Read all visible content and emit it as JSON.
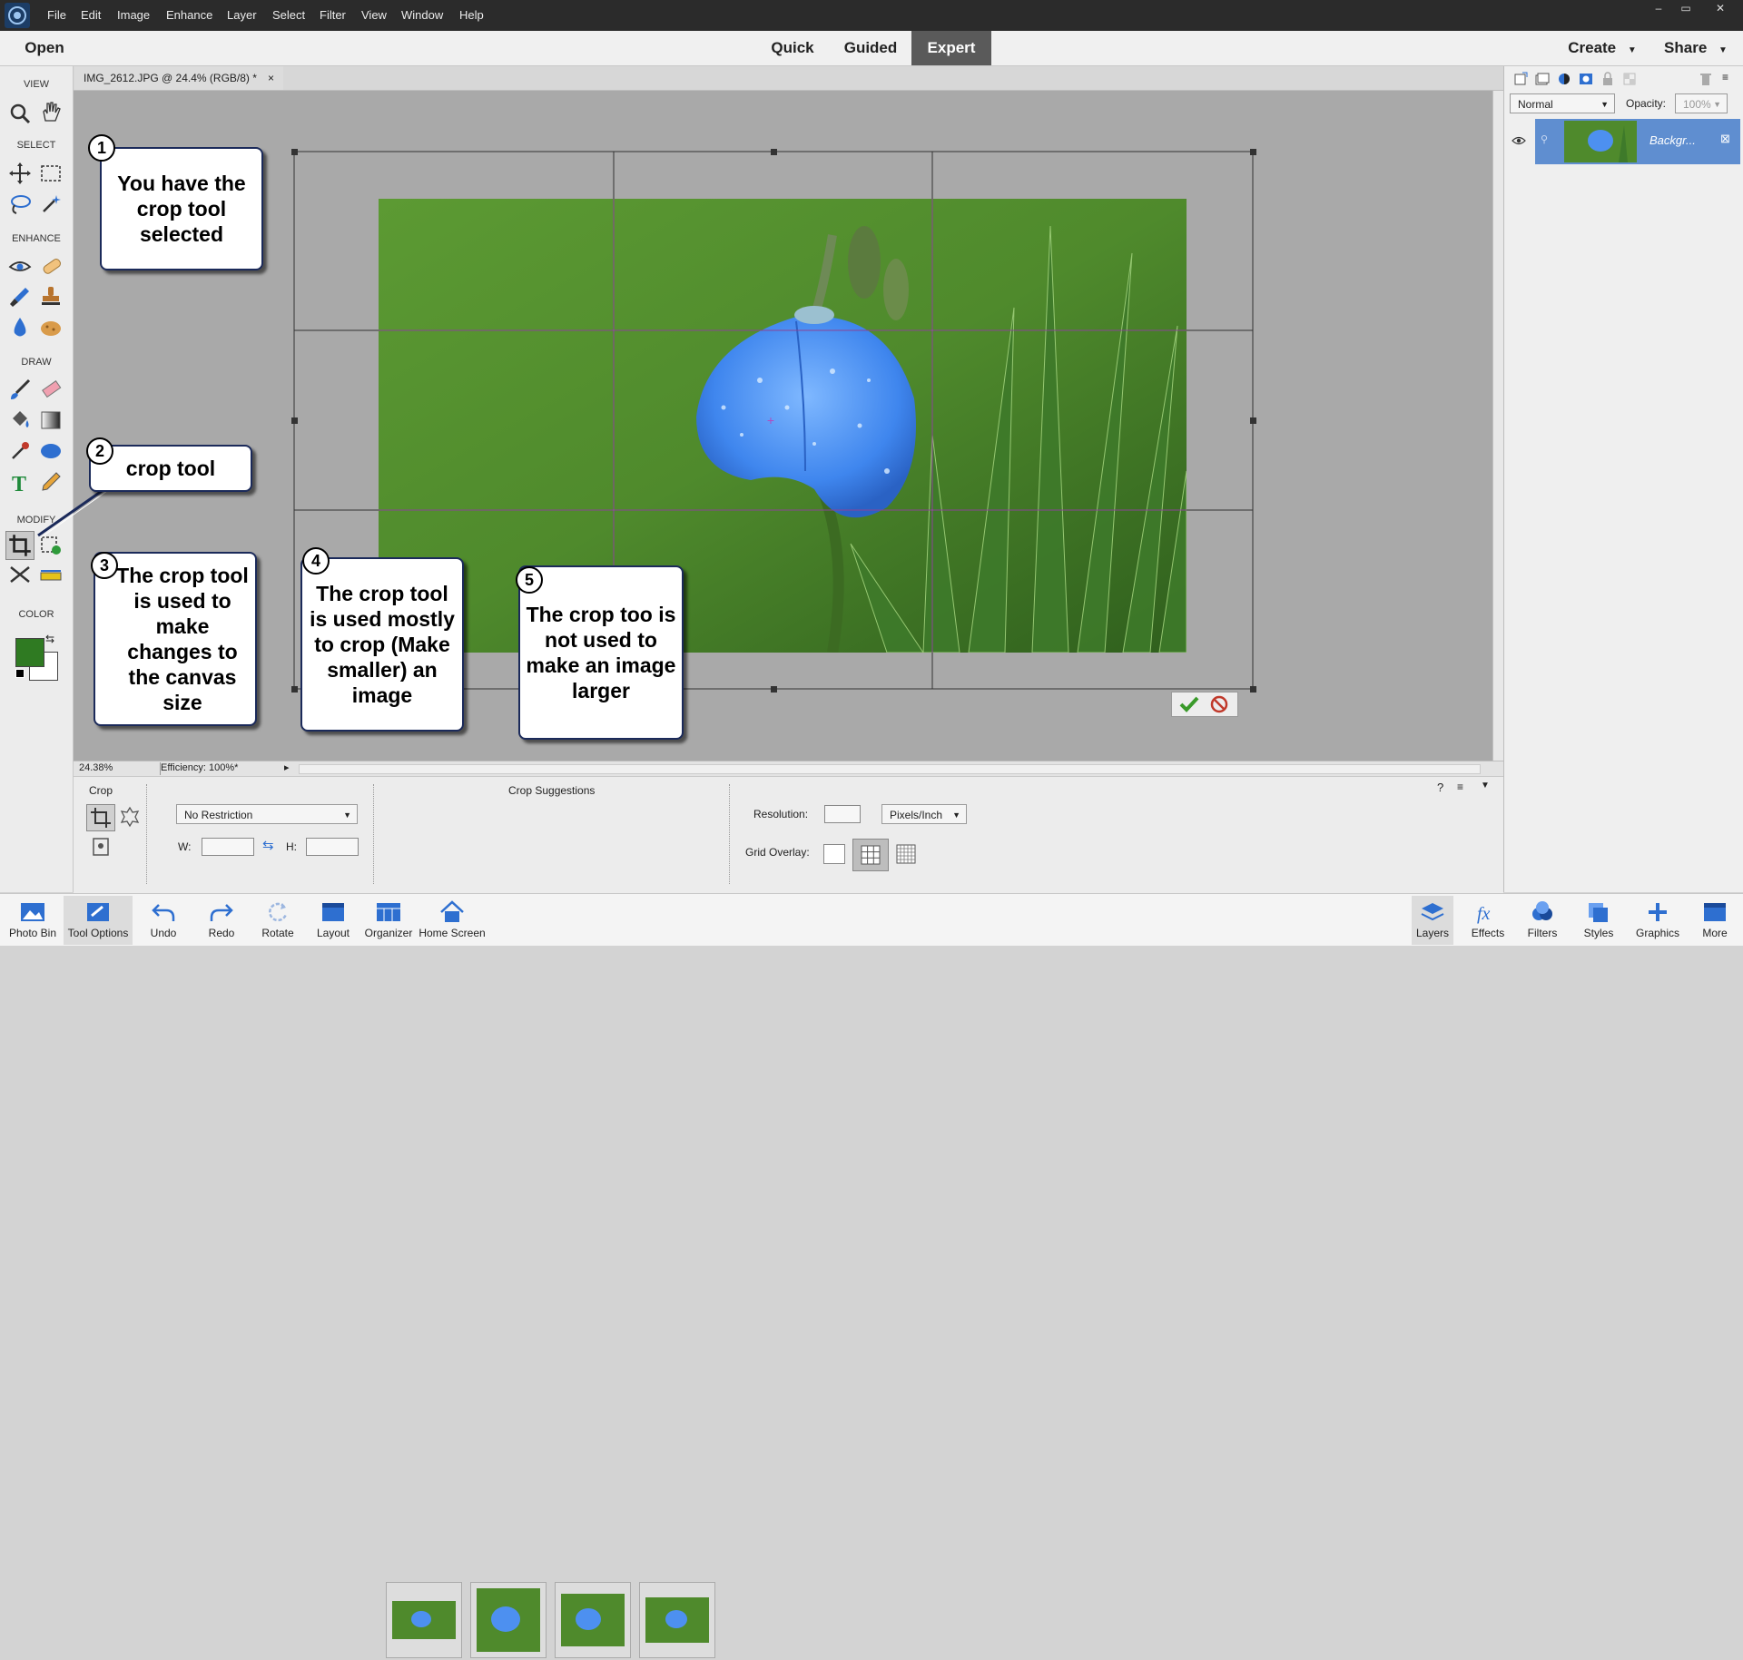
{
  "menubar": {
    "items": [
      "File",
      "Edit",
      "Image",
      "Enhance",
      "Layer",
      "Select",
      "Filter",
      "View",
      "Window",
      "Help"
    ],
    "window_controls": [
      "–",
      "▭",
      "✕"
    ]
  },
  "topbar": {
    "open_label": "Open",
    "modes": [
      "Quick",
      "Guided",
      "Expert"
    ],
    "active_mode": "Expert",
    "create_label": "Create",
    "share_label": "Share"
  },
  "toolbox": {
    "sections": [
      "VIEW",
      "SELECT",
      "ENHANCE",
      "DRAW",
      "MODIFY",
      "COLOR"
    ],
    "foreground_color": "#2f7a22",
    "background_color": "#ffffff"
  },
  "document": {
    "tab_title": "IMG_2612.JPG @ 24.4% (RGB/8) *",
    "tab_close": "×",
    "zoom": "24.38%",
    "efficiency": "Efficiency: 100%*"
  },
  "callouts": [
    {
      "number": "1",
      "text": "You have the crop tool selected"
    },
    {
      "number": "2",
      "text": "crop tool"
    },
    {
      "number": "3",
      "text": "The crop tool is used to make changes to the canvas size"
    },
    {
      "number": "4",
      "text": "The crop tool is used mostly to crop (Make smaller) an image"
    },
    {
      "number": "5",
      "text": "The crop too is not used to make an image larger"
    }
  ],
  "crop_commit": {
    "icons": [
      "checkmark-icon",
      "cancel-icon"
    ]
  },
  "layers_panel": {
    "blend_mode": "Normal",
    "opacity_label": "Opacity:",
    "opacity_value": "100%",
    "layer_name": "Backgr..."
  },
  "tool_options": {
    "title": "Crop",
    "crop_suggestions_label": "Crop Suggestions",
    "restriction": "No Restriction",
    "w_label": "W:",
    "h_label": "H:",
    "resolution_label": "Resolution:",
    "resolution_unit": "Pixels/Inch",
    "grid_overlay_label": "Grid Overlay:"
  },
  "bottombar": {
    "left": [
      "Photo Bin",
      "Tool Options",
      "Undo",
      "Redo",
      "Rotate",
      "Layout",
      "Organizer",
      "Home Screen"
    ],
    "right": [
      "Layers",
      "Effects",
      "Filters",
      "Styles",
      "Graphics",
      "More"
    ]
  },
  "colors": {
    "accent_blue": "#2e6fd0",
    "active_mode_bg": "#5a5a5a",
    "layer_selected_bg": "#5f8ed0"
  }
}
